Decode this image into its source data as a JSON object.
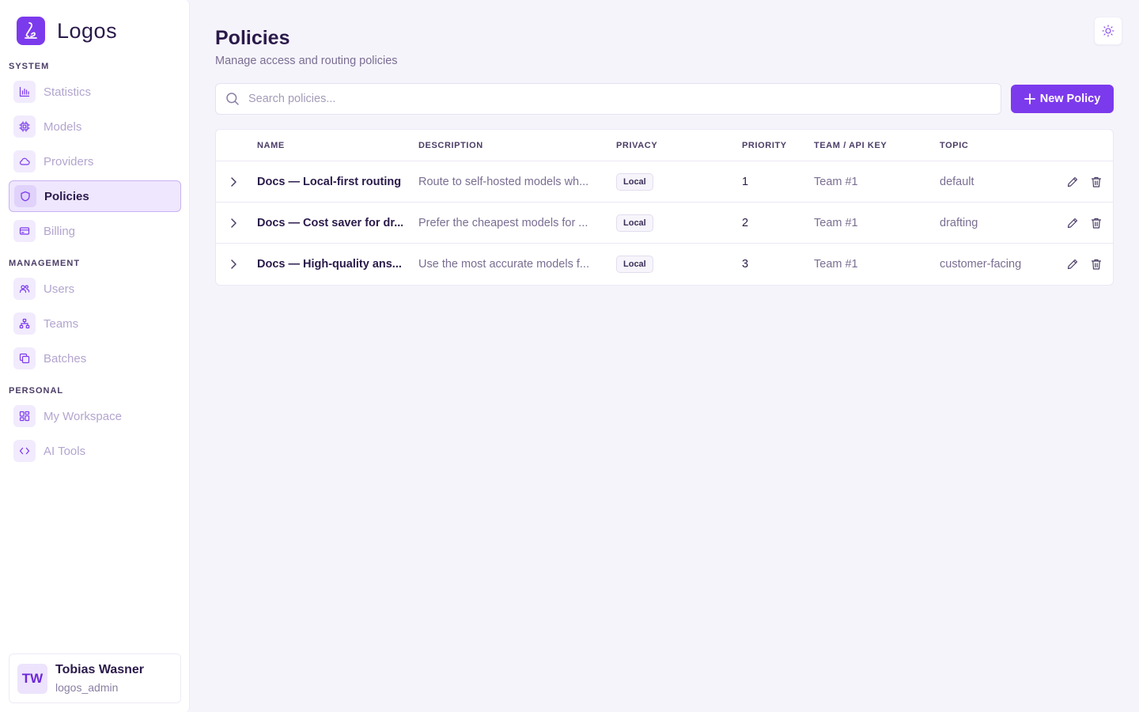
{
  "app": {
    "name": "Logos"
  },
  "sidebar": {
    "sections": [
      {
        "label": "SYSTEM"
      },
      {
        "label": "MANAGEMENT"
      },
      {
        "label": "PERSONAL"
      }
    ],
    "items": [
      {
        "label": "Statistics",
        "icon": "bar-chart-icon"
      },
      {
        "label": "Models",
        "icon": "cpu-icon"
      },
      {
        "label": "Providers",
        "icon": "cloud-icon"
      },
      {
        "label": "Policies",
        "icon": "shield-icon",
        "active": true
      },
      {
        "label": "Billing",
        "icon": "credit-card-icon"
      },
      {
        "label": "Users",
        "icon": "users-icon"
      },
      {
        "label": "Teams",
        "icon": "network-icon"
      },
      {
        "label": "Batches",
        "icon": "copy-icon"
      },
      {
        "label": "My Workspace",
        "icon": "layout-grid-icon"
      },
      {
        "label": "AI Tools",
        "icon": "code-icon"
      }
    ],
    "user": {
      "initials": "TW",
      "name": "Tobias Wasner",
      "role": "logos_admin"
    }
  },
  "header": {
    "title": "Policies",
    "subtitle": "Manage access and routing policies",
    "theme_icon": "sun-icon"
  },
  "search": {
    "placeholder": "Search policies...",
    "value": ""
  },
  "toolbar": {
    "new_label": "New Policy"
  },
  "colors": {
    "accent": "#7c3aed",
    "accent_light": "#efe7fd",
    "background": "#f6f4fb"
  },
  "table": {
    "columns": [
      "NAME",
      "DESCRIPTION",
      "PRIVACY",
      "PRIORITY",
      "TEAM / API KEY",
      "TOPIC"
    ],
    "rows": [
      {
        "name": "Docs — Local-first routing",
        "description": "Route to self-hosted models wh...",
        "privacy": "Local",
        "priority": "1",
        "team": "Team #1",
        "topic": "default"
      },
      {
        "name": "Docs — Cost saver for dr...",
        "description": "Prefer the cheapest models for ...",
        "privacy": "Local",
        "priority": "2",
        "team": "Team #1",
        "topic": "drafting"
      },
      {
        "name": "Docs — High-quality ans...",
        "description": "Use the most accurate models f...",
        "privacy": "Local",
        "priority": "3",
        "team": "Team #1",
        "topic": "customer-facing"
      }
    ]
  }
}
